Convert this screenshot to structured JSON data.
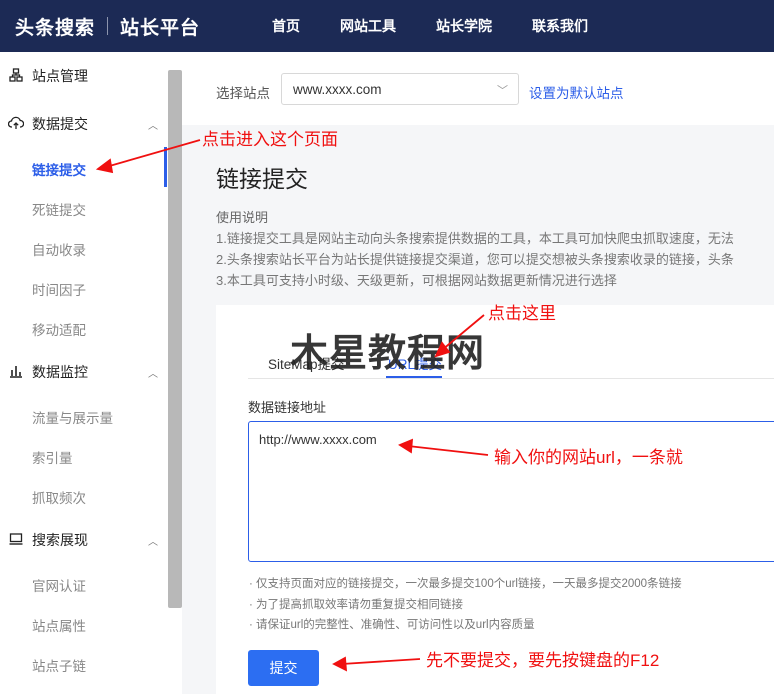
{
  "header": {
    "logo": "头条搜索",
    "platform": "站长平台",
    "nav": [
      "首页",
      "网站工具",
      "站长学院",
      "联系我们"
    ]
  },
  "sidebar": {
    "groups": [
      {
        "label": "站点管理",
        "icon": "sitemap-icon",
        "items": []
      },
      {
        "label": "数据提交",
        "icon": "upload-cloud-icon",
        "items": [
          "链接提交",
          "死链提交",
          "自动收录",
          "时间因子",
          "移动适配"
        ]
      },
      {
        "label": "数据监控",
        "icon": "bar-chart-icon",
        "items": [
          "流量与展示量",
          "索引量",
          "抓取频次"
        ]
      },
      {
        "label": "搜索展现",
        "icon": "monitor-icon",
        "items": [
          "官网认证",
          "站点属性",
          "站点子链"
        ]
      }
    ],
    "active_item": "链接提交"
  },
  "site_selector": {
    "label": "选择站点",
    "value": "www.xxxx.com",
    "default_link": "设置为默认站点"
  },
  "page": {
    "title": "链接提交",
    "usage_title": "使用说明",
    "usage_lines": [
      "1.链接提交工具是网站主动向头条搜索提供数据的工具，本工具可加快爬虫抓取速度，无法",
      "2.头条搜索站长平台为站长提供链接提交渠道，您可以提交想被头条搜索收录的链接，头条",
      "3.本工具可支持小时级、天级更新，可根据网站数据更新情况进行选择"
    ],
    "tabs": [
      "SiteMap提交",
      "URL提交"
    ],
    "active_tab": "URL提交",
    "field_label": "数据链接地址",
    "url_value": "http://www.xxxx.com",
    "notes": [
      "· 仅支持页面对应的链接提交，一次最多提交100个url链接，一天最多提交2000条链接",
      "· 为了提高抓取效率请勿重复提交相同链接",
      "· 请保证url的完整性、准确性、可访问性以及url内容质量"
    ],
    "submit_label": "提交"
  },
  "annotations": {
    "enter_page": "点击进入这个页面",
    "click_here": "点击这里",
    "input_url": "输入你的网站url，一条就",
    "press_f12": "先不要提交，要先按键盘的F12",
    "watermark": "木星教程网",
    "color": "#f01010"
  }
}
